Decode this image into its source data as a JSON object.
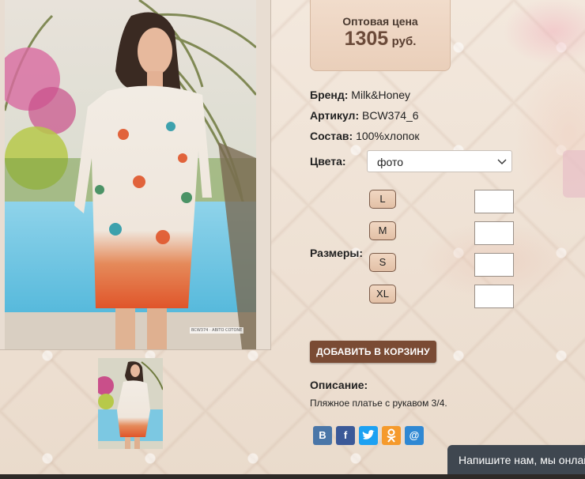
{
  "price": {
    "label": "Оптовая цена",
    "value": "1305",
    "currency": "руб."
  },
  "product": {
    "brand_label": "Бренд:",
    "brand_value": "Milk&Honey",
    "article_label": "Артикул:",
    "article_value": "BCW374_6",
    "composition_label": "Состав:",
    "composition_value": "100%хлопок",
    "photo_tag": "BCW374 · ABITO COTONE"
  },
  "colors": {
    "label": "Цвета:",
    "selected": "фото"
  },
  "sizes": {
    "label": "Размеры:",
    "items": [
      {
        "label": "L",
        "quantity": ""
      },
      {
        "label": "M",
        "quantity": ""
      },
      {
        "label": "S",
        "quantity": ""
      },
      {
        "label": "XL",
        "quantity": ""
      }
    ]
  },
  "cart_button": "ДОБАВИТЬ В КОРЗИНУ",
  "description": {
    "title": "Описание:",
    "text": "Пляжное платье с рукавом 3/4."
  },
  "share": [
    {
      "icon": "vk-icon",
      "glyph": "В",
      "color": "#4a76a8"
    },
    {
      "icon": "facebook-icon",
      "glyph": "f",
      "color": "#3b5998"
    },
    {
      "icon": "twitter-icon",
      "glyph": "t",
      "color": "#1da1f2"
    },
    {
      "icon": "odnoklassniki-icon",
      "glyph": "ок",
      "color": "#f59a2c"
    },
    {
      "icon": "mail-icon",
      "glyph": "@",
      "color": "#2f88d3"
    }
  ],
  "chat": {
    "text": "Напишите нам, мы онлайн!"
  },
  "colors_theme": {
    "accent": "#7a4b34",
    "price_box": "#eed6c3",
    "chat_bg": "#3f4750"
  }
}
